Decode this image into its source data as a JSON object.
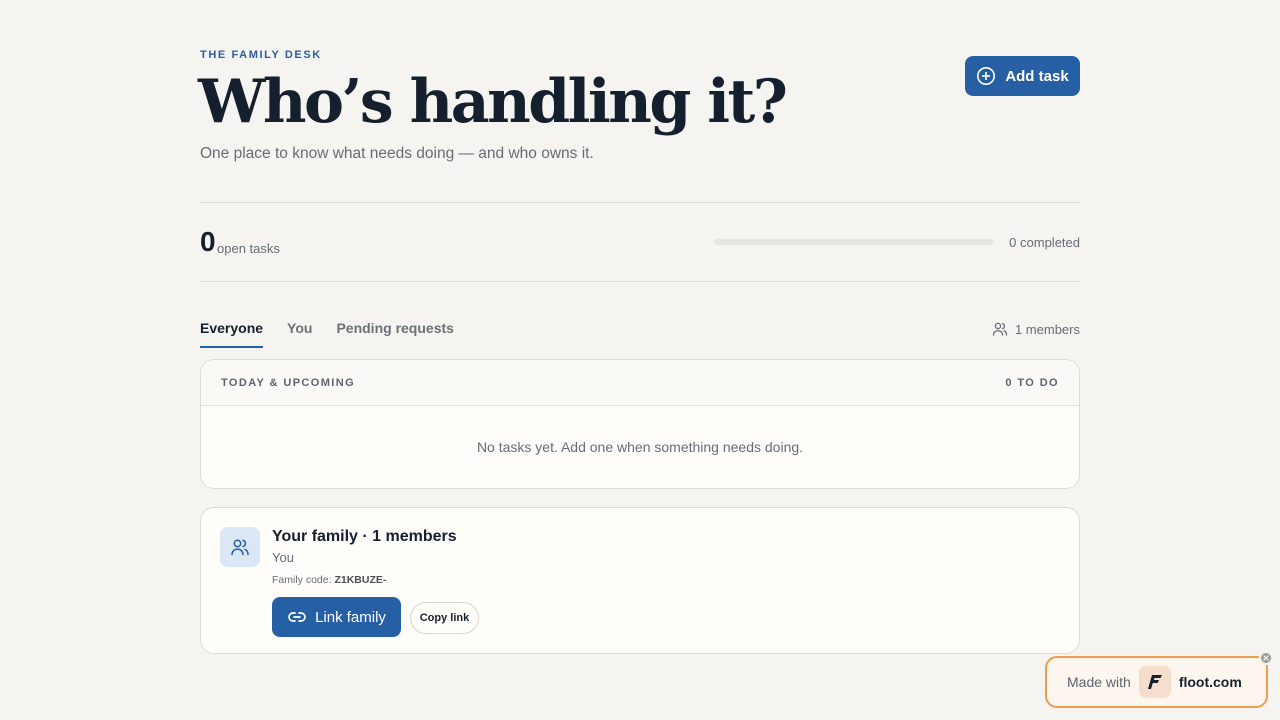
{
  "header": {
    "eyebrow": "THE FAMILY DESK",
    "title": "Who’s handling it?",
    "subtitle": "One place to know what needs doing — and who owns it.",
    "add_task_label": "Add task",
    "add_task_icon": "plus-circle-icon"
  },
  "stats": {
    "open_count": "0",
    "open_label": "open tasks",
    "completed_fraction": 0,
    "completed_text": "0 completed"
  },
  "tabs": [
    {
      "label": "Everyone",
      "active": true
    },
    {
      "label": "You",
      "active": false
    },
    {
      "label": "Pending requests",
      "active": false
    }
  ],
  "members": {
    "icon": "users-icon",
    "text": "1 members"
  },
  "tasks_card": {
    "section_title": "TODAY & UPCOMING",
    "count_text": "0 TO DO",
    "empty_text": "No tasks yet. Add one when something needs doing."
  },
  "family_card": {
    "icon": "users-icon",
    "title": "Your family · 1 members",
    "member_name": "You",
    "code_label": "Family code:",
    "code_value": "Z1KBUZE-",
    "link_label": "Link family",
    "link_icon": "link-icon",
    "copy_label": "Copy link"
  },
  "badge": {
    "made_with": "Made with",
    "brand": "floot.com"
  },
  "colors": {
    "accent": "#275fa5",
    "background": "#f5f4f0",
    "badge_border": "#ef9a4c"
  }
}
